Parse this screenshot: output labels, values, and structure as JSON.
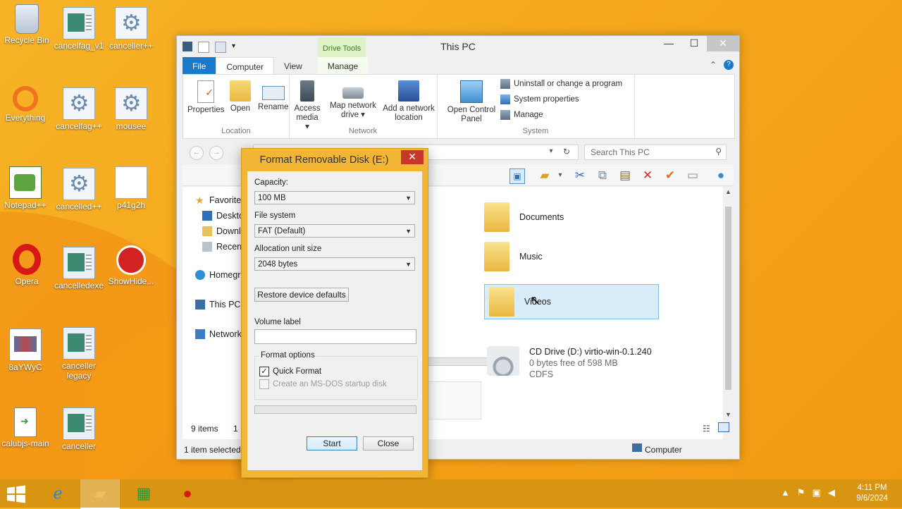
{
  "desktop": {
    "icons": [
      {
        "label": "Recycle Bin"
      },
      {
        "label": "cancelfag_v1"
      },
      {
        "label": "canceller++"
      },
      {
        "label": "Everything"
      },
      {
        "label": "cancelfag++"
      },
      {
        "label": "mousee"
      },
      {
        "label": "Notepad++"
      },
      {
        "label": "cancelled++"
      },
      {
        "label": "p41g2h"
      },
      {
        "label": "Opera"
      },
      {
        "label": "cancelledexe"
      },
      {
        "label": "ShowHide..."
      },
      {
        "label": "8aYWyC"
      },
      {
        "label": "canceller legacy"
      },
      {
        "label": "calubjs-main"
      },
      {
        "label": "canceller"
      }
    ]
  },
  "explorer": {
    "title": "This PC",
    "contextual_tab": "Drive Tools",
    "tabs": {
      "file": "File",
      "computer": "Computer",
      "view": "View",
      "manage": "Manage"
    },
    "ribbon": {
      "location": {
        "name": "Location",
        "properties": "Properties",
        "open": "Open",
        "rename": "Rename"
      },
      "network": {
        "name": "Network",
        "access_media": "Access media ▾",
        "map_drive": "Map network drive ▾",
        "add_location": "Add a network location"
      },
      "system": {
        "name": "System",
        "open_cp": "Open Control Panel",
        "uninstall": "Uninstall or change a program",
        "sys_props": "System properties",
        "manage": "Manage"
      }
    },
    "search_placeholder": "Search This PC",
    "nav": {
      "favorites": "Favorites",
      "desktop": "Desktop",
      "downloads": "Downloads",
      "recent": "Recent places",
      "homegroup": "Homegroup",
      "this_pc": "This PC",
      "network": "Network"
    },
    "folders": {
      "documents": "Documents",
      "music": "Music",
      "videos": "Videos"
    },
    "cd_drive": {
      "name": "CD Drive (D:) virtio-win-0.1.240",
      "free": "0 bytes free of 598 MB",
      "fs": "CDFS"
    },
    "status": {
      "items": "9 items",
      "items_extra": "1",
      "selected": "1 item selected",
      "location": "Computer"
    }
  },
  "dialog": {
    "title": "Format Removable Disk (E:)",
    "capacity_label": "Capacity:",
    "capacity_value": "100 MB",
    "fs_label": "File system",
    "fs_value": "FAT (Default)",
    "alloc_label": "Allocation unit size",
    "alloc_value": "2048 bytes",
    "restore_btn": "Restore device defaults",
    "volume_label": "Volume label",
    "volume_value": "",
    "format_options": "Format options",
    "quick_format": "Quick Format",
    "quick_format_checked": true,
    "msdos": "Create an MS-DOS startup disk",
    "start_btn": "Start",
    "close_btn": "Close"
  },
  "taskbar": {
    "time": "4:11 PM",
    "date": "9/6/2024"
  },
  "colors": {
    "accent": "#1979ca",
    "wallpaper": "#f5a81e",
    "drive_tools": "#dff3c7"
  }
}
